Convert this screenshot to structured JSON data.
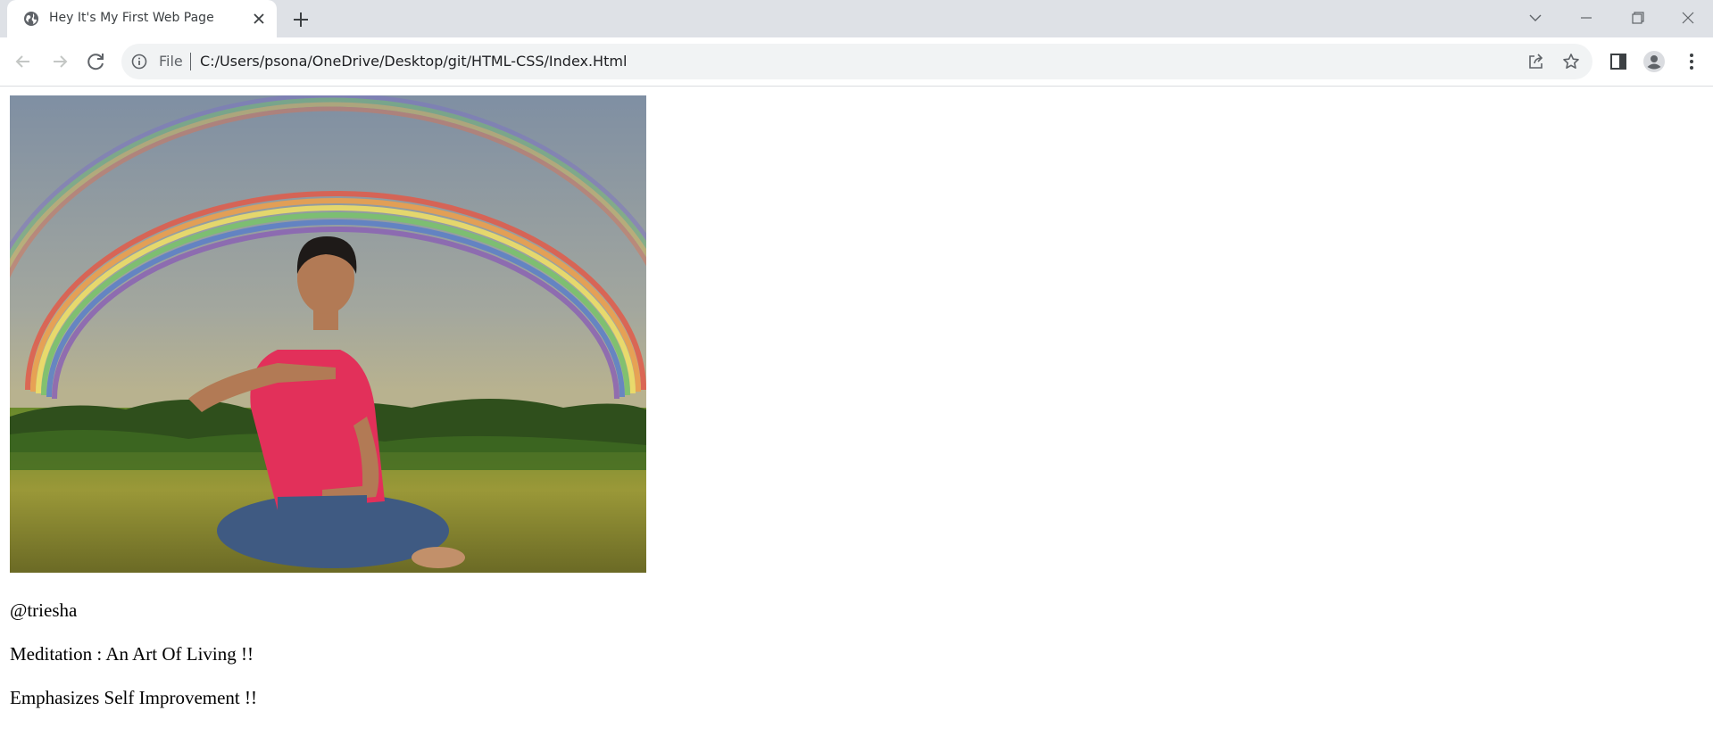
{
  "browser": {
    "tab": {
      "title": "Hey It's My First Web Page",
      "favicon": "globe-icon"
    },
    "address_bar": {
      "scheme_label": "File",
      "url": "C:/Users/psona/OneDrive/Desktop/git/HTML-CSS/Index.Html"
    },
    "colors": {
      "tabbar": "#dee1e6",
      "omnibox": "#f1f3f4",
      "icon": "#5f6368"
    }
  },
  "page": {
    "image": {
      "description_icon": "meditation-rainbow-photo"
    },
    "lines": [
      "@triesha",
      "Meditation : An Art Of Living !!",
      "Emphasizes Self Improvement !!"
    ]
  }
}
